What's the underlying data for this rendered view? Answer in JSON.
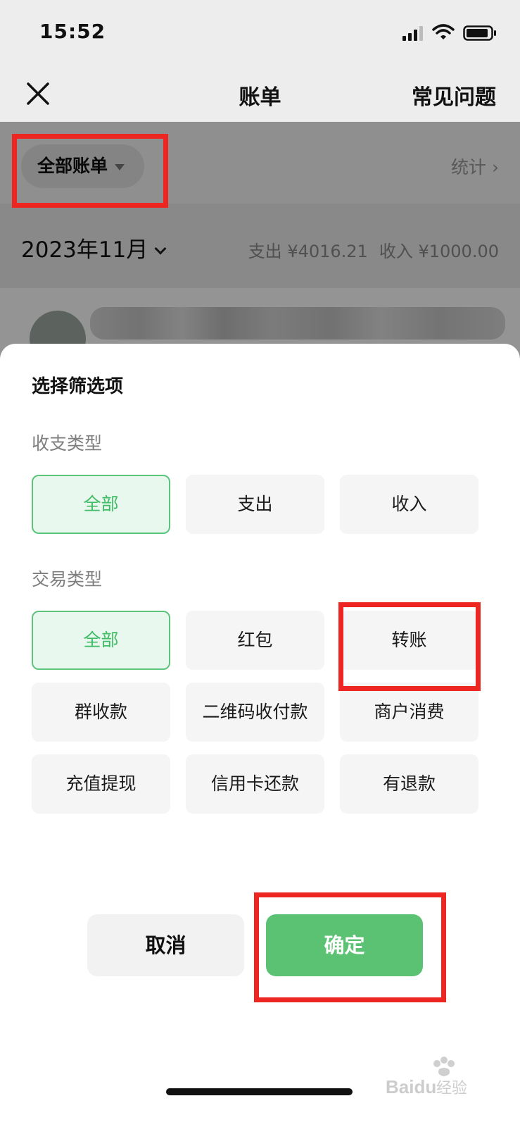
{
  "status_bar": {
    "time": "15:52"
  },
  "nav": {
    "title": "账单",
    "faq": "常见问题"
  },
  "filter": {
    "all_bills": "全部账单",
    "stats": "统计"
  },
  "month_row": {
    "month": "2023年11月",
    "expense": "支出 ¥4016.21",
    "income": "收入 ¥1000.00"
  },
  "sheet": {
    "title": "选择筛选项",
    "flow_type": {
      "label": "收支类型",
      "options": [
        "全部",
        "支出",
        "收入"
      ],
      "selected": "全部"
    },
    "trade_type": {
      "label": "交易类型",
      "options": [
        "全部",
        "红包",
        "转账",
        "群收款",
        "二维码收付款",
        "商户消费",
        "充值提现",
        "信用卡还款",
        "有退款"
      ],
      "selected": "全部"
    },
    "cancel": "取消",
    "confirm": "确定"
  },
  "watermark": {
    "text": "Baidu经验"
  },
  "colors": {
    "accent": "#5bc273",
    "highlight": "#ee2622",
    "selected_text": "#3ebc63"
  }
}
